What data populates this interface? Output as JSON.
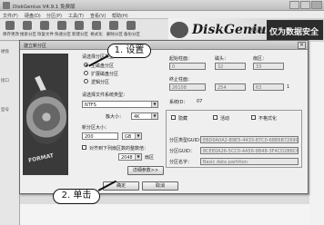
{
  "window": {
    "title": "DiskGenius V4.9.1 免费版",
    "menu": [
      "文件(F)",
      "硬盘(D)",
      "分区(P)",
      "工具(T)",
      "查看(V)",
      "帮助(H)"
    ]
  },
  "toolbar": {
    "buttons": [
      "保存更改",
      "搜索分区",
      "恢复文件",
      "快速分区",
      "新建分区",
      "格式化",
      "删除分区",
      "备份分区"
    ]
  },
  "brand": {
    "logo_text": "DiskGenius",
    "suffix": "专业版",
    "slogan": "仅为数据安全"
  },
  "sidebar": {
    "labels": [
      "硬盘",
      "接口",
      "型号"
    ]
  },
  "dialog": {
    "title": "建立新分区",
    "close_label": "×",
    "format_label": "FORMAT",
    "partition_type_group": "请选择分区类型：",
    "partition_types": [
      {
        "label": "主磁盘分区",
        "selected": true
      },
      {
        "label": "扩展磁盘分区",
        "selected": false
      },
      {
        "label": "逻辑分区",
        "selected": false
      }
    ],
    "fs_label": "请选择文件系统类型：",
    "fs_value": "NTFS",
    "cluster_label": "簇大小：",
    "cluster_value": "4K",
    "size_label": "新分区大小：",
    "size_value": "200",
    "size_unit": "GB",
    "align_check_label": "对齐到下列扇区数的整数倍：",
    "align_value": "2048",
    "align_unit": "扇区",
    "advanced_button": "详细参数>>",
    "ok_button": "确定",
    "cancel_button": "取消",
    "right": {
      "start_label": "起始柱面：",
      "start_cyl": "0",
      "head_label": "磁头：",
      "start_head": "32",
      "sector_label": "扇区：",
      "start_sector": "33",
      "end_label": "终止柱面：",
      "end_cyl": "26108",
      "end_head": "254",
      "end_sector": "63",
      "extra_col": "1",
      "id_label": "系统ID：",
      "id_value": "07",
      "hidden_check": "隐藏",
      "active_check": "活动",
      "bootable_check": "不格式化",
      "guid_label1": "分区类型GUID：",
      "guid_value1": "EBD0A0A2-B9E5-4433-87C0-68B6B72699C7",
      "guid_label2": "分区GUID：",
      "guid_value2": "8CEE0A26-5CC0-4A56-9B48-3F4CD2B8C61D",
      "name_label": "分区名字：",
      "name_value": "Basic data partition"
    }
  },
  "callouts": {
    "step1": "1. 设置",
    "step2": "2. 单击"
  }
}
